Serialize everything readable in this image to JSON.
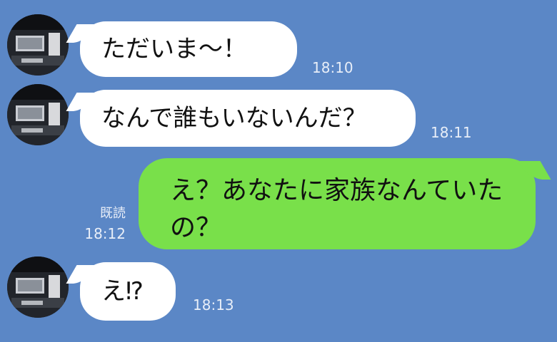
{
  "messages": [
    {
      "side": "in",
      "text": "ただいま〜！",
      "time": "18:10"
    },
    {
      "side": "in",
      "text": "なんで誰もいないんだ？",
      "time": "18:11"
    },
    {
      "side": "out",
      "text": "え？あなたに家族なんていたの？",
      "time": "18:12",
      "read": "既読"
    },
    {
      "side": "in",
      "text": "え⁉",
      "time": "18:13"
    }
  ],
  "colors": {
    "background": "#5b87c6",
    "incoming_bubble": "#ffffff",
    "outgoing_bubble": "#79e04a"
  },
  "icons": {
    "avatar": "room-interior-photo"
  }
}
